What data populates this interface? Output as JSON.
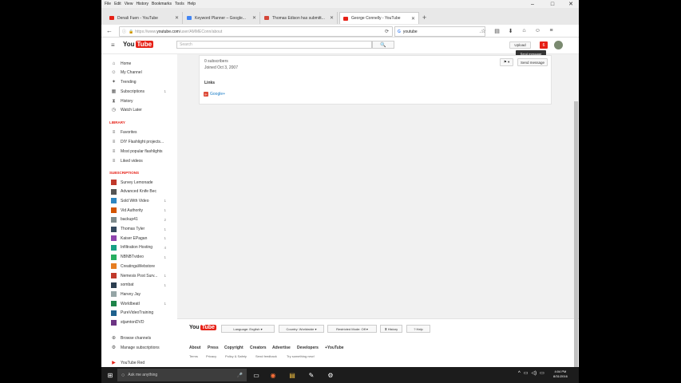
{
  "menubar": {
    "items": [
      "File",
      "Edit",
      "View",
      "History",
      "Bookmarks",
      "Tools",
      "Help"
    ]
  },
  "window_controls": {
    "minimize": "–",
    "restore": "□",
    "close": "✕"
  },
  "tabs": [
    {
      "title": "Denali Fuen - YouTube",
      "favicon_color": "#e62117",
      "active": false
    },
    {
      "title": "Keyword Planner – Google...",
      "favicon_color": "#4285f4",
      "active": false
    },
    {
      "title": "Thomas Edison has submitt...",
      "favicon_color": "#d44638",
      "active": false
    },
    {
      "title": "George Connelly - YouTube",
      "favicon_color": "#e62117",
      "active": true
    }
  ],
  "newtab": "+",
  "navbar": {
    "back": "←",
    "info": "ⓘ",
    "url_prefix": "https://www.",
    "url_domain": "youtube.com",
    "url_rest": "/user/AMMEConn/about",
    "reload": "⟳",
    "search_value": "youtube",
    "search_engine_icon": "G",
    "go": "→",
    "tool_icons": [
      "☆",
      "▤",
      "⬇",
      "⌂",
      "☺",
      "≡"
    ]
  },
  "youtube": {
    "logo_you": "You",
    "logo_tube": "Tube",
    "search_placeholder": "Search",
    "search_button": "🔍",
    "upload_label": "Upload",
    "notif_count": "6",
    "tooltip": "Send message",
    "menu_icon": "≡"
  },
  "sidebar": {
    "main": [
      {
        "label": "Home",
        "icon": "⌂"
      },
      {
        "label": "My Channel",
        "icon": "☺"
      },
      {
        "label": "Trending",
        "icon": "✦"
      },
      {
        "label": "Subscriptions",
        "icon": "▦",
        "count": "1"
      },
      {
        "label": "History",
        "icon": "⧗"
      },
      {
        "label": "Watch Later",
        "icon": "◷"
      }
    ],
    "library_header": "LIBRARY",
    "library": [
      {
        "label": "Favorites"
      },
      {
        "label": "DIY Flashlight projects..."
      },
      {
        "label": "Most popular flashlights"
      },
      {
        "label": "Liked videos"
      }
    ],
    "subs_header": "SUBSCRIPTIONS",
    "subscriptions": [
      {
        "label": "Survey Lemonade",
        "color": "#c0392b",
        "count": ""
      },
      {
        "label": "Advanced Knife Bec",
        "color": "#555555",
        "count": ""
      },
      {
        "label": "Sold With Video",
        "color": "#2e86c1",
        "count": "1"
      },
      {
        "label": "Vid Authority",
        "color": "#d35400",
        "count": "1"
      },
      {
        "label": "backup41",
        "color": "#7f8c8d",
        "count": "2"
      },
      {
        "label": "Thomas Tyler",
        "color": "#34495e",
        "count": "1"
      },
      {
        "label": "Kaiser EPagan",
        "color": "#8e44ad",
        "count": "1"
      },
      {
        "label": "Infiltration Hosting",
        "color": "#16a085",
        "count": "4"
      },
      {
        "label": "NBNBTvideo",
        "color": "#27ae60",
        "count": "1"
      },
      {
        "label": "CreatingaWebstore",
        "color": "#e67e22",
        "count": ""
      },
      {
        "label": "Nemesis Post Surv...",
        "color": "#c0392b",
        "count": "1"
      },
      {
        "label": "sombat",
        "color": "#2c3e50",
        "count": "1"
      },
      {
        "label": "Harvey Jay",
        "color": "#95a5a6",
        "count": ""
      },
      {
        "label": "WorldbeatI",
        "color": "#1e8449",
        "count": "1"
      },
      {
        "label": "PureVideoTraining",
        "color": "#1f618d",
        "count": ""
      },
      {
        "label": "stjamtonDVD",
        "color": "#6c3483",
        "count": ""
      }
    ],
    "bottom": [
      {
        "label": "Browse channels",
        "icon": "⊕"
      },
      {
        "label": "Manage subscriptions",
        "icon": "⚙"
      },
      {
        "label": "YouTube Red",
        "icon": "▶"
      }
    ]
  },
  "about": {
    "subscribers": "0 subscribers",
    "joined": "Joined Oct 3, 2007",
    "flag_label": "⚑ ▾",
    "send_message": "Send message",
    "links_header": "Links",
    "link_label": "Google+",
    "link_icon": "g+"
  },
  "footer": {
    "language": "Language: English ▾",
    "country": "Country: Worldwide ▾",
    "restricted": "Restricted Mode: Off ▾",
    "history": "⧗ History",
    "help": "? Help",
    "links": [
      "About",
      "Press",
      "Copyright",
      "Creators",
      "Advertise",
      "Developers",
      "+YouTube"
    ],
    "small_links": [
      "Terms",
      "Privacy",
      "Policy & Safety",
      "Send feedback",
      "Try something new!"
    ]
  },
  "taskbar": {
    "start_icon": "⊞",
    "search_placeholder": "Ask me anything",
    "mic_icon": "🎤",
    "apps": [
      "▭",
      "◉",
      "▤",
      "✎",
      "⚙"
    ],
    "tray": [
      "^",
      "▭",
      "◁)",
      "▭"
    ],
    "time": "4:04 PM",
    "date": "8/31/2016"
  }
}
